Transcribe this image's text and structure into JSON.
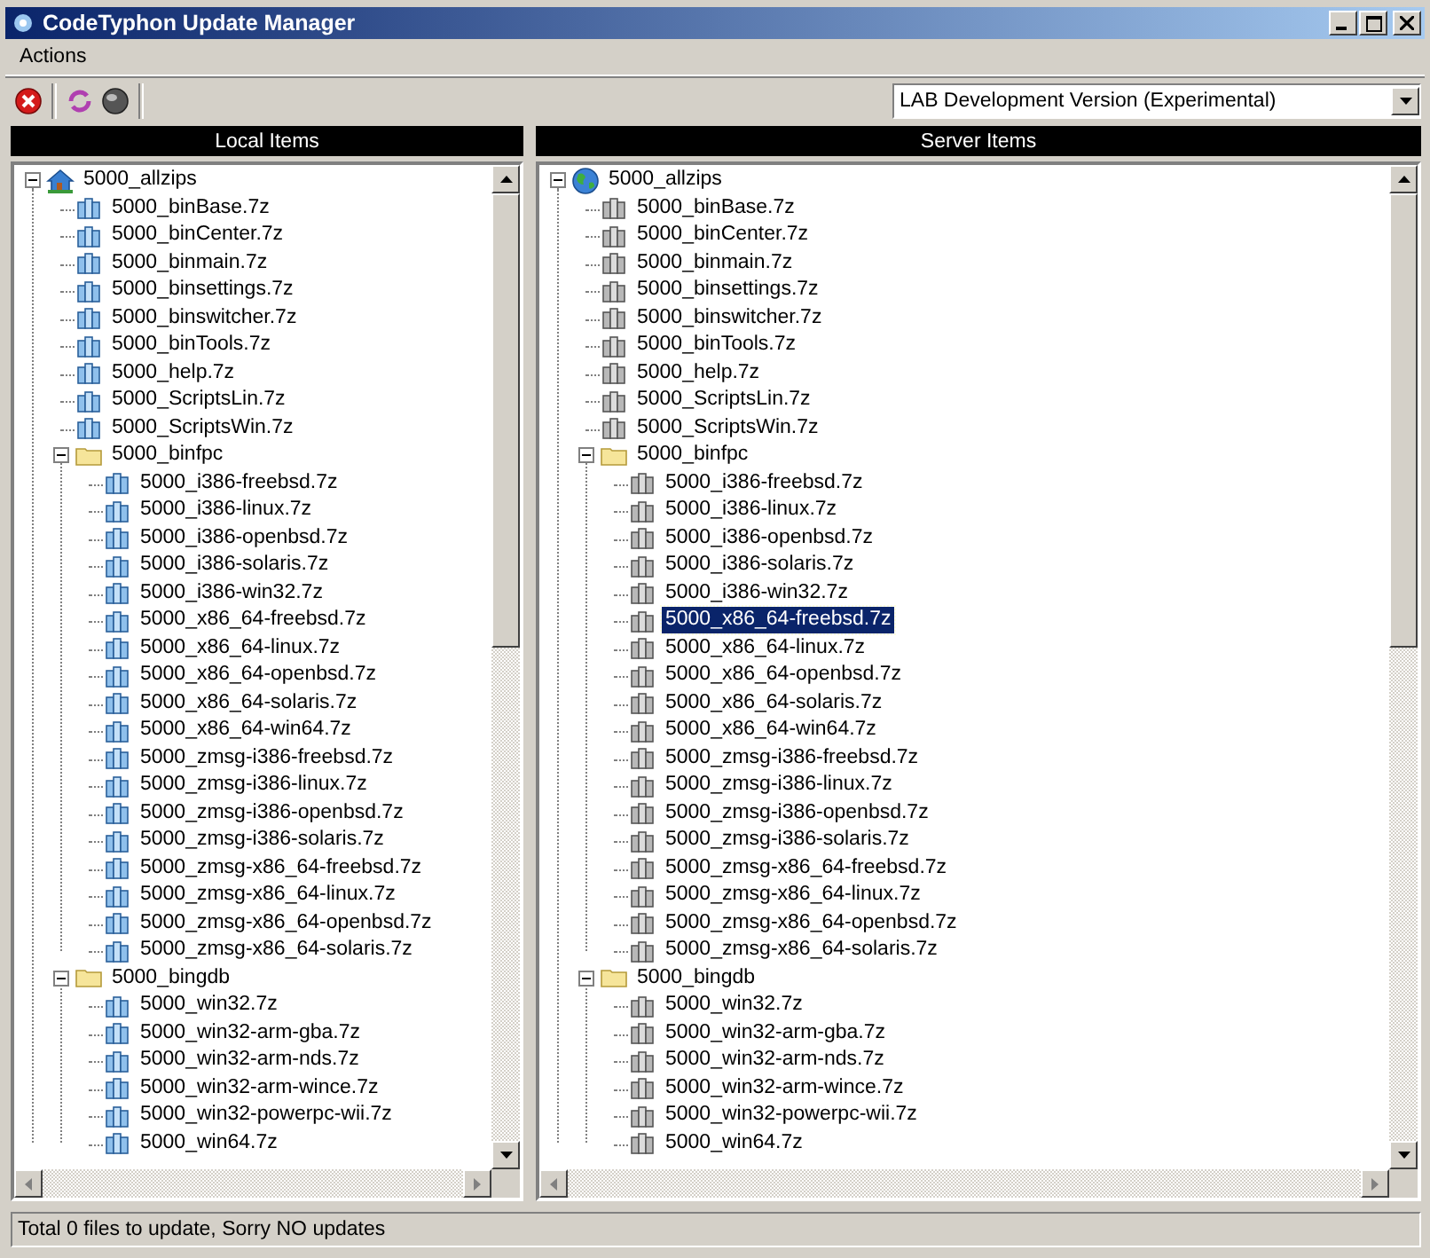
{
  "window": {
    "title": "CodeTyphon Update Manager"
  },
  "menu": [
    {
      "label": "Actions"
    }
  ],
  "version_dropdown": {
    "value": "LAB Development Version (Experimental)"
  },
  "panes": [
    {
      "header": "Local Items",
      "root": {
        "label": "5000_allzips",
        "kind": "root",
        "expanded": true,
        "selected": false,
        "children": [
          {
            "label": "5000_binBase.7z",
            "kind": "file",
            "selected": false
          },
          {
            "label": "5000_binCenter.7z",
            "kind": "file",
            "selected": false
          },
          {
            "label": "5000_binmain.7z",
            "kind": "file",
            "selected": false
          },
          {
            "label": "5000_binsettings.7z",
            "kind": "file",
            "selected": false
          },
          {
            "label": "5000_binswitcher.7z",
            "kind": "file",
            "selected": false
          },
          {
            "label": "5000_binTools.7z",
            "kind": "file",
            "selected": false
          },
          {
            "label": "5000_help.7z",
            "kind": "file",
            "selected": false
          },
          {
            "label": "5000_ScriptsLin.7z",
            "kind": "file",
            "selected": false
          },
          {
            "label": "5000_ScriptsWin.7z",
            "kind": "file",
            "selected": false
          },
          {
            "label": "5000_binfpc",
            "kind": "folder",
            "expanded": true,
            "selected": false,
            "children": [
              {
                "label": "5000_i386-freebsd.7z",
                "kind": "file",
                "selected": false
              },
              {
                "label": "5000_i386-linux.7z",
                "kind": "file",
                "selected": false
              },
              {
                "label": "5000_i386-openbsd.7z",
                "kind": "file",
                "selected": false
              },
              {
                "label": "5000_i386-solaris.7z",
                "kind": "file",
                "selected": false
              },
              {
                "label": "5000_i386-win32.7z",
                "kind": "file",
                "selected": false
              },
              {
                "label": "5000_x86_64-freebsd.7z",
                "kind": "file",
                "selected": false
              },
              {
                "label": "5000_x86_64-linux.7z",
                "kind": "file",
                "selected": false
              },
              {
                "label": "5000_x86_64-openbsd.7z",
                "kind": "file",
                "selected": false
              },
              {
                "label": "5000_x86_64-solaris.7z",
                "kind": "file",
                "selected": false
              },
              {
                "label": "5000_x86_64-win64.7z",
                "kind": "file",
                "selected": false
              },
              {
                "label": "5000_zmsg-i386-freebsd.7z",
                "kind": "file",
                "selected": false
              },
              {
                "label": "5000_zmsg-i386-linux.7z",
                "kind": "file",
                "selected": false
              },
              {
                "label": "5000_zmsg-i386-openbsd.7z",
                "kind": "file",
                "selected": false
              },
              {
                "label": "5000_zmsg-i386-solaris.7z",
                "kind": "file",
                "selected": false
              },
              {
                "label": "5000_zmsg-x86_64-freebsd.7z",
                "kind": "file",
                "selected": false
              },
              {
                "label": "5000_zmsg-x86_64-linux.7z",
                "kind": "file",
                "selected": false
              },
              {
                "label": "5000_zmsg-x86_64-openbsd.7z",
                "kind": "file",
                "selected": false
              },
              {
                "label": "5000_zmsg-x86_64-solaris.7z",
                "kind": "file",
                "selected": false
              }
            ]
          },
          {
            "label": "5000_bingdb",
            "kind": "folder",
            "expanded": true,
            "selected": false,
            "children": [
              {
                "label": "5000_win32.7z",
                "kind": "file",
                "selected": false
              },
              {
                "label": "5000_win32-arm-gba.7z",
                "kind": "file",
                "selected": false
              },
              {
                "label": "5000_win32-arm-nds.7z",
                "kind": "file",
                "selected": false
              },
              {
                "label": "5000_win32-arm-wince.7z",
                "kind": "file",
                "selected": false
              },
              {
                "label": "5000_win32-powerpc-wii.7z",
                "kind": "file",
                "selected": false
              },
              {
                "label": "5000_win64.7z",
                "kind": "file",
                "selected": false
              }
            ]
          }
        ]
      }
    },
    {
      "header": "Server Items",
      "root": {
        "label": "5000_allzips",
        "kind": "root",
        "expanded": true,
        "selected": false,
        "children": [
          {
            "label": "5000_binBase.7z",
            "kind": "file",
            "selected": false
          },
          {
            "label": "5000_binCenter.7z",
            "kind": "file",
            "selected": false
          },
          {
            "label": "5000_binmain.7z",
            "kind": "file",
            "selected": false
          },
          {
            "label": "5000_binsettings.7z",
            "kind": "file",
            "selected": false
          },
          {
            "label": "5000_binswitcher.7z",
            "kind": "file",
            "selected": false
          },
          {
            "label": "5000_binTools.7z",
            "kind": "file",
            "selected": false
          },
          {
            "label": "5000_help.7z",
            "kind": "file",
            "selected": false
          },
          {
            "label": "5000_ScriptsLin.7z",
            "kind": "file",
            "selected": false
          },
          {
            "label": "5000_ScriptsWin.7z",
            "kind": "file",
            "selected": false
          },
          {
            "label": "5000_binfpc",
            "kind": "folder",
            "expanded": true,
            "selected": false,
            "children": [
              {
                "label": "5000_i386-freebsd.7z",
                "kind": "file",
                "selected": false
              },
              {
                "label": "5000_i386-linux.7z",
                "kind": "file",
                "selected": false
              },
              {
                "label": "5000_i386-openbsd.7z",
                "kind": "file",
                "selected": false
              },
              {
                "label": "5000_i386-solaris.7z",
                "kind": "file",
                "selected": false
              },
              {
                "label": "5000_i386-win32.7z",
                "kind": "file",
                "selected": false
              },
              {
                "label": "5000_x86_64-freebsd.7z",
                "kind": "file",
                "selected": true
              },
              {
                "label": "5000_x86_64-linux.7z",
                "kind": "file",
                "selected": false
              },
              {
                "label": "5000_x86_64-openbsd.7z",
                "kind": "file",
                "selected": false
              },
              {
                "label": "5000_x86_64-solaris.7z",
                "kind": "file",
                "selected": false
              },
              {
                "label": "5000_x86_64-win64.7z",
                "kind": "file",
                "selected": false
              },
              {
                "label": "5000_zmsg-i386-freebsd.7z",
                "kind": "file",
                "selected": false
              },
              {
                "label": "5000_zmsg-i386-linux.7z",
                "kind": "file",
                "selected": false
              },
              {
                "label": "5000_zmsg-i386-openbsd.7z",
                "kind": "file",
                "selected": false
              },
              {
                "label": "5000_zmsg-i386-solaris.7z",
                "kind": "file",
                "selected": false
              },
              {
                "label": "5000_zmsg-x86_64-freebsd.7z",
                "kind": "file",
                "selected": false
              },
              {
                "label": "5000_zmsg-x86_64-linux.7z",
                "kind": "file",
                "selected": false
              },
              {
                "label": "5000_zmsg-x86_64-openbsd.7z",
                "kind": "file",
                "selected": false
              },
              {
                "label": "5000_zmsg-x86_64-solaris.7z",
                "kind": "file",
                "selected": false
              }
            ]
          },
          {
            "label": "5000_bingdb",
            "kind": "folder",
            "expanded": true,
            "selected": false,
            "children": [
              {
                "label": "5000_win32.7z",
                "kind": "file",
                "selected": false
              },
              {
                "label": "5000_win32-arm-gba.7z",
                "kind": "file",
                "selected": false
              },
              {
                "label": "5000_win32-arm-nds.7z",
                "kind": "file",
                "selected": false
              },
              {
                "label": "5000_win32-arm-wince.7z",
                "kind": "file",
                "selected": false
              },
              {
                "label": "5000_win32-powerpc-wii.7z",
                "kind": "file",
                "selected": false
              },
              {
                "label": "5000_win64.7z",
                "kind": "file",
                "selected": false
              }
            ]
          }
        ]
      }
    }
  ],
  "status_bar": {
    "text": "Total 0 files to update, Sorry NO updates"
  }
}
